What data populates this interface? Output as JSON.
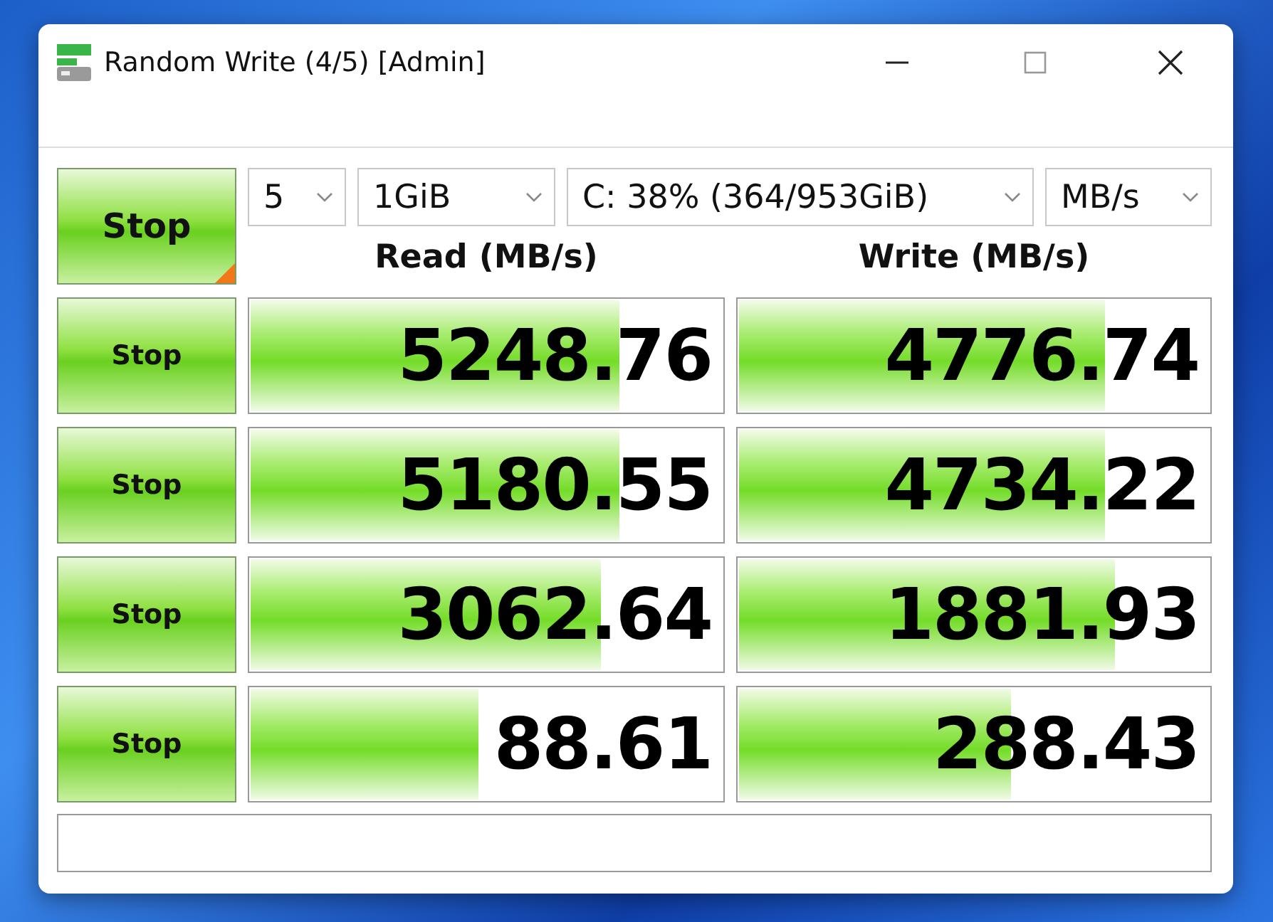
{
  "window": {
    "title": "Random Write (4/5) [Admin]"
  },
  "controls": {
    "all_button": "Stop",
    "count": "5",
    "size": "1GiB",
    "drive": "C: 38% (364/953GiB)",
    "unit": "MB/s"
  },
  "headers": [
    "Read (MB/s)",
    "Write (MB/s)"
  ],
  "rows": [
    {
      "button": "Stop",
      "read": {
        "value": "5248.76",
        "level": 0.785
      },
      "write": {
        "value": "4776.74",
        "level": 0.78
      }
    },
    {
      "button": "Stop",
      "read": {
        "value": "5180.55",
        "level": 0.785
      },
      "write": {
        "value": "4734.22",
        "level": 0.78
      }
    },
    {
      "button": "Stop",
      "read": {
        "value": "3062.64",
        "level": 0.746
      },
      "write": {
        "value": "1881.93",
        "level": 0.8
      }
    },
    {
      "button": "Stop",
      "read": {
        "value": "88.61",
        "level": 0.487
      },
      "write": {
        "value": "288.43",
        "level": 0.58
      }
    }
  ]
}
